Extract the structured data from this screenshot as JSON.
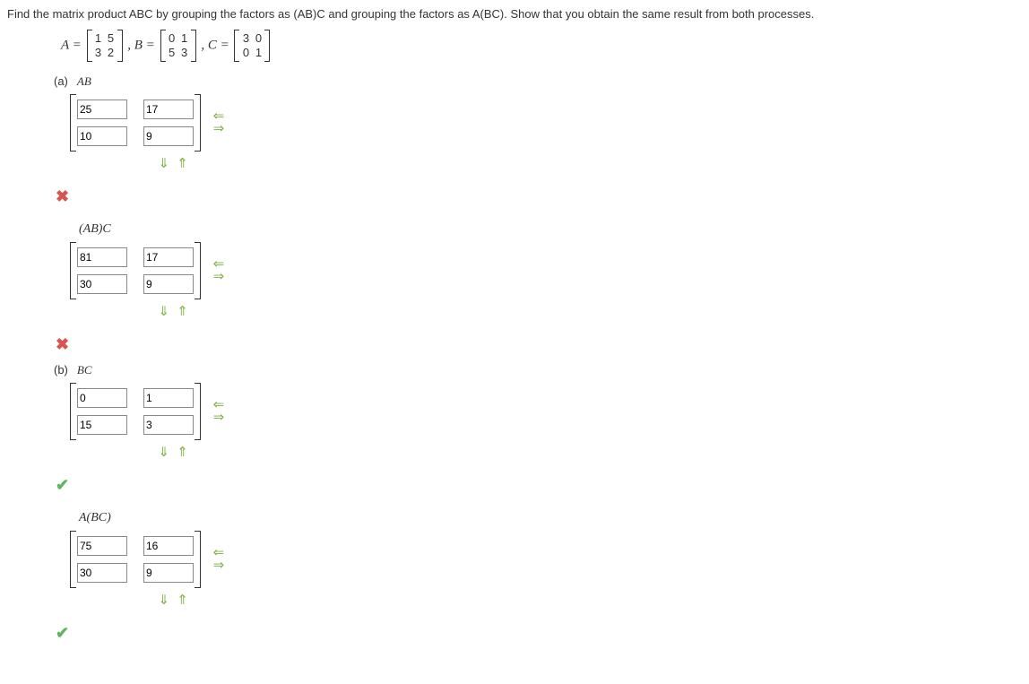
{
  "prompt": "Find the matrix product ABC by grouping the factors as (AB)C and grouping the factors as A(BC). Show that you obtain the same result from both processes.",
  "matrices": {
    "A_label": "A =",
    "A": [
      [
        "1",
        "5"
      ],
      [
        "3",
        "2"
      ]
    ],
    "B_label": ", B =",
    "B": [
      [
        "0",
        "1"
      ],
      [
        "5",
        "3"
      ]
    ],
    "C_label": ", C =",
    "C": [
      [
        "3",
        "0"
      ],
      [
        "0",
        "1"
      ]
    ]
  },
  "parts": {
    "a": {
      "label": "(a)",
      "var": "AB",
      "grid": [
        [
          "25",
          "17"
        ],
        [
          "10",
          "9"
        ]
      ],
      "sub_label": "(AB)C",
      "grid2": [
        [
          "81",
          "17"
        ],
        [
          "30",
          "9"
        ]
      ],
      "feedback1": "wrong",
      "feedback2": "wrong"
    },
    "b": {
      "label": "(b)",
      "var": "BC",
      "grid": [
        [
          "0",
          "1"
        ],
        [
          "15",
          "3"
        ]
      ],
      "sub_label": "A(BC)",
      "grid2": [
        [
          "75",
          "16"
        ],
        [
          "30",
          "9"
        ]
      ],
      "feedback1": "right",
      "feedback2": "right"
    }
  },
  "icons": {
    "arrow_left": "⇐",
    "arrow_right": "⇒",
    "arrow_down": "⇓",
    "arrow_up": "⇑",
    "cross": "✖",
    "check": "✔"
  }
}
